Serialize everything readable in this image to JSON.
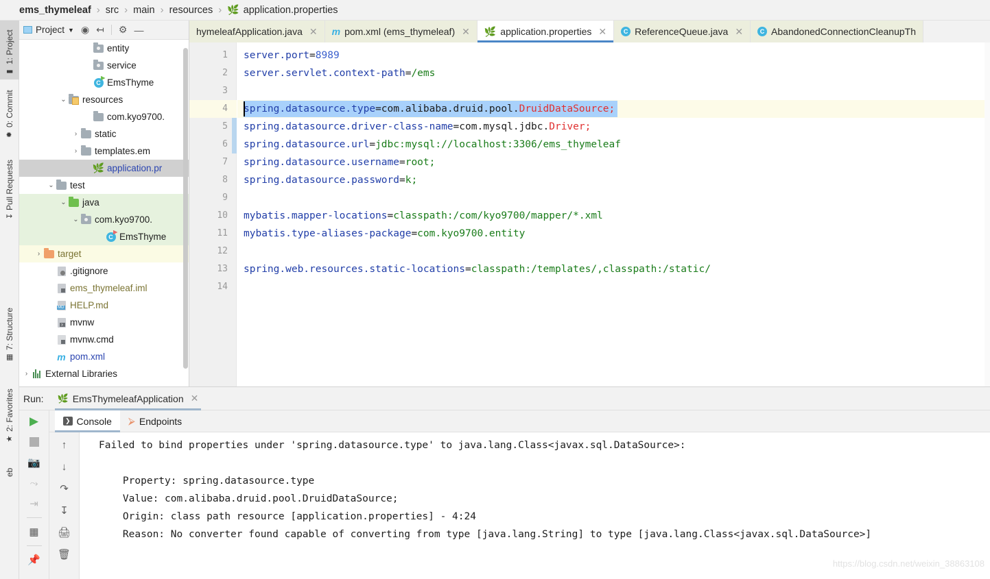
{
  "breadcrumb": {
    "items": [
      "ems_thymeleaf",
      "src",
      "main",
      "resources"
    ],
    "file": "application.properties",
    "separator": "›",
    "file_icon": "leaf-properties-icon"
  },
  "left_strip": {
    "buttons": [
      {
        "label": "1: Project",
        "icon": "folder-icon",
        "active": true
      },
      {
        "label": "0: Commit",
        "icon": "commit-icon",
        "active": false
      },
      {
        "label": "Pull Requests",
        "icon": "pull-request-icon",
        "active": false
      },
      {
        "label": "7: Structure",
        "icon": "structure-icon",
        "active": false
      },
      {
        "label": "2: Favorites",
        "icon": "star-icon",
        "active": false
      },
      {
        "label": "eb",
        "icon": "web-icon",
        "active": false
      }
    ]
  },
  "project_panel": {
    "title": "Project",
    "toolbar_icons": [
      "target-locate-icon",
      "collapse-all-icon",
      "gear-icon",
      "minimize-icon"
    ],
    "tree": [
      {
        "label": "entity",
        "indent": 5,
        "arrow": "",
        "icon": "package-folder-icon",
        "color": "dark",
        "bg": ""
      },
      {
        "label": "service",
        "indent": 5,
        "arrow": "",
        "icon": "package-folder-icon",
        "color": "dark",
        "bg": ""
      },
      {
        "label": "EmsThyme",
        "indent": 5,
        "arrow": "",
        "icon": "java-class-run-icon",
        "color": "dark",
        "bg": ""
      },
      {
        "label": "resources",
        "indent": 3,
        "arrow": "v",
        "icon": "resources-folder-icon",
        "color": "dark",
        "bg": ""
      },
      {
        "label": "com.kyo9700.",
        "indent": 5,
        "arrow": "",
        "icon": "folder-icon",
        "color": "dark",
        "bg": ""
      },
      {
        "label": "static",
        "indent": 4,
        "arrow": ">",
        "icon": "folder-icon",
        "color": "dark",
        "bg": ""
      },
      {
        "label": "templates.em",
        "indent": 4,
        "arrow": ">",
        "icon": "folder-icon",
        "color": "dark",
        "bg": ""
      },
      {
        "label": "application.pr",
        "indent": 5,
        "arrow": "",
        "icon": "leaf-properties-icon",
        "color": "blue",
        "bg": "sel-grey"
      },
      {
        "label": "test",
        "indent": 2,
        "arrow": "v",
        "icon": "folder-icon",
        "color": "dark",
        "bg": ""
      },
      {
        "label": "java",
        "indent": 3,
        "arrow": "v",
        "icon": "source-folder-icon",
        "color": "dark",
        "bg": "bg-green"
      },
      {
        "label": "com.kyo9700.",
        "indent": 4,
        "arrow": "v",
        "icon": "package-folder-icon",
        "color": "dark",
        "bg": "bg-green"
      },
      {
        "label": "EmsThyme",
        "indent": 6,
        "arrow": "",
        "icon": "java-class-test-icon",
        "color": "dark",
        "bg": "bg-green"
      },
      {
        "label": "target",
        "indent": 1,
        "arrow": ">",
        "icon": "excluded-folder-icon",
        "color": "olive",
        "bg": "bg-yellow"
      },
      {
        "label": ".gitignore",
        "indent": 2,
        "arrow": "",
        "icon": "gitignore-file-icon",
        "color": "dark",
        "bg": ""
      },
      {
        "label": "ems_thymeleaf.iml",
        "indent": 2,
        "arrow": "",
        "icon": "iml-file-icon",
        "color": "olive",
        "bg": ""
      },
      {
        "label": "HELP.md",
        "indent": 2,
        "arrow": "",
        "icon": "markdown-file-icon",
        "color": "olive",
        "bg": ""
      },
      {
        "label": "mvnw",
        "indent": 2,
        "arrow": "",
        "icon": "shell-file-icon",
        "color": "dark",
        "bg": ""
      },
      {
        "label": "mvnw.cmd",
        "indent": 2,
        "arrow": "",
        "icon": "text-file-icon",
        "color": "dark",
        "bg": ""
      },
      {
        "label": "pom.xml",
        "indent": 2,
        "arrow": "",
        "icon": "maven-icon",
        "color": "blue",
        "bg": ""
      },
      {
        "label": "External Libraries",
        "indent": 0,
        "arrow": ">",
        "icon": "libraries-icon",
        "color": "dark",
        "bg": ""
      }
    ]
  },
  "editor_tabs": [
    {
      "label": "hymeleafApplication.java",
      "icon": "",
      "active": false,
      "closable": true
    },
    {
      "label": "pom.xml (ems_thymeleaf)",
      "icon": "maven-icon",
      "active": false,
      "closable": true
    },
    {
      "label": "application.properties",
      "icon": "leaf-properties-icon",
      "active": true,
      "closable": true
    },
    {
      "label": "ReferenceQueue.java",
      "icon": "java-class-icon",
      "active": false,
      "closable": true
    },
    {
      "label": "AbandonedConnectionCleanupTh",
      "icon": "java-class-icon",
      "active": false,
      "closable": false
    }
  ],
  "editor": {
    "file": "application.properties",
    "line_numbers": [
      1,
      2,
      3,
      4,
      5,
      6,
      7,
      8,
      9,
      10,
      11,
      12,
      13,
      14
    ],
    "caret_line": 4,
    "caret_column": 1,
    "selected_line": 4,
    "lines": [
      {
        "n": 1,
        "tokens": [
          {
            "t": "server.port",
            "c": "key"
          },
          {
            "t": "=",
            "c": "punc"
          },
          {
            "t": "8989",
            "c": "num"
          }
        ]
      },
      {
        "n": 2,
        "tokens": [
          {
            "t": "server.servlet.context-path",
            "c": "key"
          },
          {
            "t": "=",
            "c": "punc"
          },
          {
            "t": "/ems",
            "c": "val"
          }
        ]
      },
      {
        "n": 3,
        "tokens": []
      },
      {
        "n": 4,
        "tokens": [
          {
            "t": "spring.datasource.type",
            "c": "key"
          },
          {
            "t": "=com",
            "c": "punc"
          },
          {
            "t": ".",
            "c": "punc"
          },
          {
            "t": "alibaba",
            "c": "punc"
          },
          {
            "t": ".druid.pool.",
            "c": "punc"
          },
          {
            "t": "DruidDataSource;",
            "c": "err"
          }
        ]
      },
      {
        "n": 5,
        "tokens": [
          {
            "t": "spring.datasource.driver-class-name",
            "c": "key"
          },
          {
            "t": "=com.mysql.jdbc.",
            "c": "punc"
          },
          {
            "t": "Driver;",
            "c": "err"
          }
        ]
      },
      {
        "n": 6,
        "tokens": [
          {
            "t": "spring.datasource.url",
            "c": "key"
          },
          {
            "t": "=",
            "c": "punc"
          },
          {
            "t": "jdbc:mysql://localhost:3306/ems_thymeleaf",
            "c": "val"
          }
        ]
      },
      {
        "n": 7,
        "tokens": [
          {
            "t": "spring.datasource.username",
            "c": "key"
          },
          {
            "t": "=",
            "c": "punc"
          },
          {
            "t": "root;",
            "c": "val"
          }
        ]
      },
      {
        "n": 8,
        "tokens": [
          {
            "t": "spring.datasource.password",
            "c": "key"
          },
          {
            "t": "=",
            "c": "punc"
          },
          {
            "t": "k;",
            "c": "val"
          }
        ]
      },
      {
        "n": 9,
        "tokens": []
      },
      {
        "n": 10,
        "tokens": [
          {
            "t": "mybatis.mapper-locations",
            "c": "key"
          },
          {
            "t": "=",
            "c": "punc"
          },
          {
            "t": "classpath:/com/kyo9700/mapper/*.xml",
            "c": "val"
          }
        ]
      },
      {
        "n": 11,
        "tokens": [
          {
            "t": "mybatis.type-aliases-package",
            "c": "key"
          },
          {
            "t": "=",
            "c": "punc"
          },
          {
            "t": "com.kyo9700.entity",
            "c": "val"
          }
        ]
      },
      {
        "n": 12,
        "tokens": []
      },
      {
        "n": 13,
        "tokens": [
          {
            "t": "spring.web.resources.static-locations",
            "c": "key"
          },
          {
            "t": "=",
            "c": "punc"
          },
          {
            "t": "classpath:/templates/,classpath:/static/",
            "c": "val"
          }
        ]
      },
      {
        "n": 14,
        "tokens": []
      }
    ]
  },
  "run_panel": {
    "run_label": "Run:",
    "config_name": "EmsThymeleafApplication",
    "config_icon": "leaf-spring-icon",
    "tabs": [
      {
        "label": "Console",
        "icon": "console-icon",
        "active": true
      },
      {
        "label": "Endpoints",
        "icon": "endpoints-icon",
        "active": false
      }
    ],
    "side_icons": [
      "rerun-icon",
      "stop-icon",
      "camera-icon",
      "thread-dump-icon",
      "exit-icon",
      "layout-icon",
      "pin-icon"
    ],
    "side_icons2": [
      "scroll-up-icon",
      "scroll-down-icon",
      "soft-wrap-icon",
      "scroll-to-end-icon",
      "print-icon",
      "clear-all-icon"
    ],
    "console_lines": [
      "Failed to bind properties under 'spring.datasource.type' to java.lang.Class<javax.sql.DataSource>:",
      "",
      "    Property: spring.datasource.type",
      "    Value: com.alibaba.druid.pool.DruidDataSource;",
      "    Origin: class path resource [application.properties] - 4:24",
      "    Reason: No converter found capable of converting from type [java.lang.String] to type [java.lang.Class<javax.sql.DataSource>]"
    ]
  },
  "watermark": "https://blog.csdn.net/weixin_38863108",
  "colors": {
    "accent_tab": "#4a86c7",
    "selection": "#a8d1fb",
    "caret_line": "#fdfbe8",
    "error_red": "#e03030",
    "value_green": "#1a7c1a",
    "key_blue": "#213ea8",
    "source_folder_green": "#e6f2de",
    "excluded_folder_yellow": "#fbfbe4",
    "inactive_tab": "#eceedd"
  }
}
